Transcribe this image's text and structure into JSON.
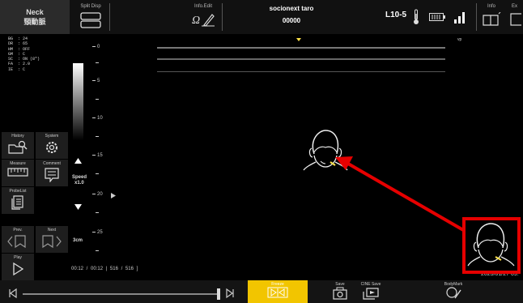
{
  "header": {
    "panel_title_line1": "Neck",
    "panel_title_line2": "頸動脈",
    "split_disp_label": "Split Disp",
    "info_edit_label": "Info.Edit",
    "patient_name": "socionext taro",
    "patient_id": "00000",
    "probe_name": "L10-5",
    "info_label": "Info",
    "exit_label": "Ex"
  },
  "params": "BG  : 24\nDR  : 65\nHM  : OFF\nGM  : C\nSC  : ON (8\")\nFA  : 2.0\nIE  : C",
  "left_buttons": [
    {
      "label": "History"
    },
    {
      "label": "System"
    },
    {
      "label": "Measure"
    },
    {
      "label": "Comment"
    },
    {
      "label": "ProbeList"
    },
    {
      "label": "Prev."
    },
    {
      "label": "Next"
    },
    {
      "label": "Play"
    }
  ],
  "depth_ticks": [
    "0",
    "5",
    "10",
    "15",
    "20",
    "25"
  ],
  "speed_label": "Speed",
  "speed_value": "x1.0",
  "depth_value": "3cm",
  "frame_info": "00:12  /  00:12  |   516  /   516  ]",
  "vp_label": "vp",
  "datetime": "2023/01/27 09:",
  "bottom": {
    "freeze_label": "Freeze",
    "save_label": "Save",
    "cine_save_label": "CINE Save",
    "body_mark_label": "BodyMark"
  },
  "colors": {
    "freeze": "#f2c500",
    "highlight_box": "#e60000",
    "arrow": "#e60000",
    "focus_marker": "#ffe14a"
  }
}
